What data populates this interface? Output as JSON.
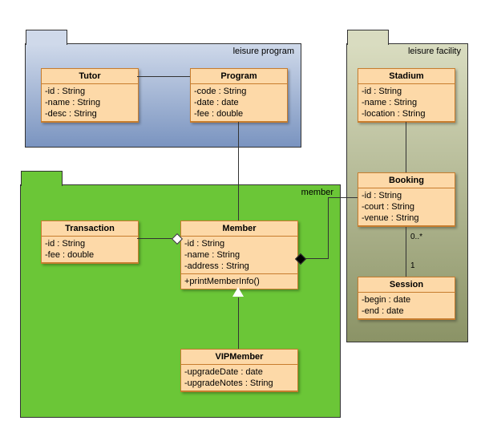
{
  "chart_data": {
    "type": "uml-class-diagram",
    "packages": [
      "leisure program",
      "member",
      "leisure facility"
    ],
    "relations": [
      "Tutor — Program (assoc)",
      "Program — Member (assoc)",
      "Transaction ◇— Member (aggregation)",
      "Member ◆— Booking (composition)",
      "VIPMember —▷ Member (inherit)",
      "Stadium — Booking (assoc)",
      "Booking 0..* — 1 Session (assoc)"
    ]
  },
  "pkg": {
    "program": "leisure program",
    "member": "member",
    "facility": "leisure facility"
  },
  "tutor": {
    "n": "Tutor",
    "a1": "-id : String",
    "a2": "-name : String",
    "a3": "-desc : String"
  },
  "program": {
    "n": "Program",
    "a1": "-code : String",
    "a2": "-date : date",
    "a3": "-fee : double"
  },
  "stadium": {
    "n": "Stadium",
    "a1": "-id : String",
    "a2": "-name : String",
    "a3": "-location : String"
  },
  "booking": {
    "n": "Booking",
    "a1": "-id : String",
    "a2": "-court : String",
    "a3": "-venue : String"
  },
  "session": {
    "n": "Session",
    "a1": "-begin : date",
    "a2": "-end : date"
  },
  "transaction": {
    "n": "Transaction",
    "a1": "-id : String",
    "a2": "-fee : double"
  },
  "member": {
    "n": "Member",
    "a1": "-id : String",
    "a2": "-name : String",
    "a3": "-address : String",
    "op": "+printMemberInfo()"
  },
  "vip": {
    "n": "VIPMember",
    "a1": "-upgradeDate : date",
    "a2": "-upgradeNotes : String"
  },
  "mult": {
    "m1": "0..*",
    "m2": "1"
  }
}
